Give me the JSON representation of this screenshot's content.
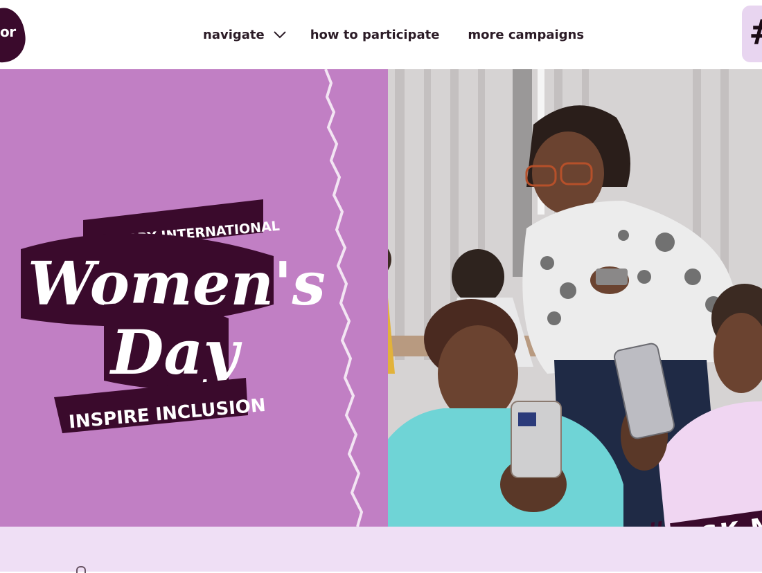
{
  "header": {
    "logo_text": "or",
    "nav": {
      "item1": "navigate",
      "item2": "how to participate",
      "item3": "more campaigns"
    },
    "hash_button": "#"
  },
  "hero": {
    "badge_hash": "#",
    "badge_text": "ASK M",
    "logo_text": "Women's Day"
  },
  "colors": {
    "purple_panel": "#c17fc4",
    "dark_plum": "#3a0a2c",
    "footer_band": "#efdff5"
  }
}
